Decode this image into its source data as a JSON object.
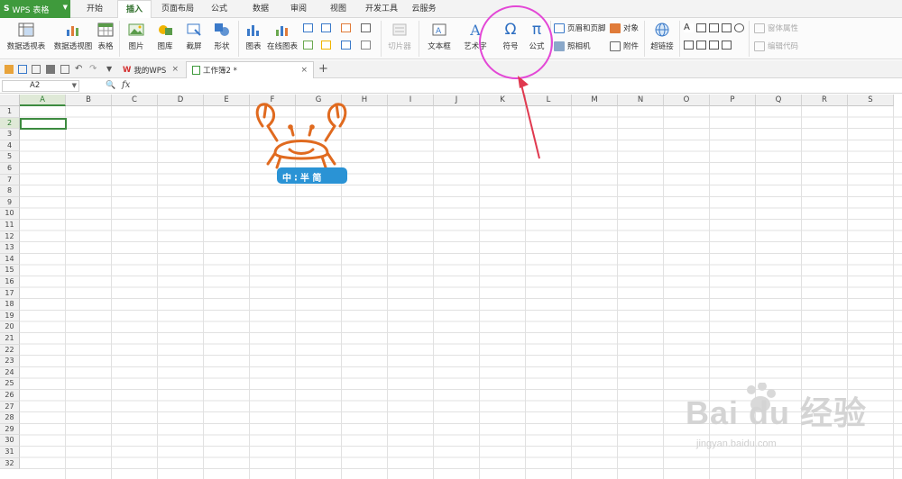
{
  "app": {
    "logo": "S",
    "title": "WPS 表格",
    "dropdown": "▼"
  },
  "menu_tabs": [
    {
      "label": "开始"
    },
    {
      "label": "插入"
    },
    {
      "label": "页面布局"
    },
    {
      "label": "公式"
    },
    {
      "label": "数据"
    },
    {
      "label": "审阅"
    },
    {
      "label": "视图"
    },
    {
      "label": "开发工具"
    },
    {
      "label": "云服务"
    }
  ],
  "active_tab": "插入",
  "ribbon": {
    "pivot_table": "数据透视表",
    "pivot_chart": "数据透视图",
    "table": "表格",
    "picture": "图片",
    "gallery": "图库",
    "screenshot": "截屏",
    "shapes": "形状",
    "chart": "图表",
    "online_chart": "在线图表",
    "slicer": "切片器",
    "textbox": "文本框",
    "wordart": "艺术字",
    "symbol": "符号",
    "formula": "公式",
    "header_footer": "页眉和页脚",
    "object": "对象",
    "camera": "照相机",
    "attachment": "附件",
    "hyperlink": "超链接",
    "form_properties": "窗体属性",
    "edit_code": "编辑代码",
    "symbol_glyph": "Ω",
    "formula_glyph": "π"
  },
  "doc_tabs": [
    {
      "label": "我的WPS",
      "close": "×"
    },
    {
      "label": "工作簿2 *",
      "close": "×"
    }
  ],
  "new_tab": "+",
  "formula_bar": {
    "cell_ref": "A2",
    "fx": "fx",
    "zoom_glyph": "🔍",
    "value": ""
  },
  "columns": [
    "A",
    "B",
    "C",
    "D",
    "E",
    "F",
    "G",
    "H",
    "I",
    "J",
    "K",
    "L",
    "M",
    "N",
    "O",
    "P",
    "Q",
    "R",
    "S"
  ],
  "rows": [
    "1",
    "2",
    "3",
    "4",
    "5",
    "6",
    "7",
    "8",
    "9",
    "10",
    "11",
    "12",
    "13",
    "14",
    "15",
    "16",
    "17",
    "18",
    "19",
    "20",
    "21",
    "22",
    "23",
    "24",
    "25",
    "26",
    "27",
    "28",
    "29",
    "30",
    "31",
    "32"
  ],
  "selected_cell": {
    "column": "A",
    "row": "2"
  },
  "watermarks": {
    "crab_label": "中 ∶ 半 简",
    "brand": "Bai du 经验",
    "brand_url": "jingyan.baidu.com"
  },
  "colors": {
    "accent_green": "#3f9a3c",
    "highlight_circle": "#e347d6",
    "arrow": "#e0394f"
  }
}
